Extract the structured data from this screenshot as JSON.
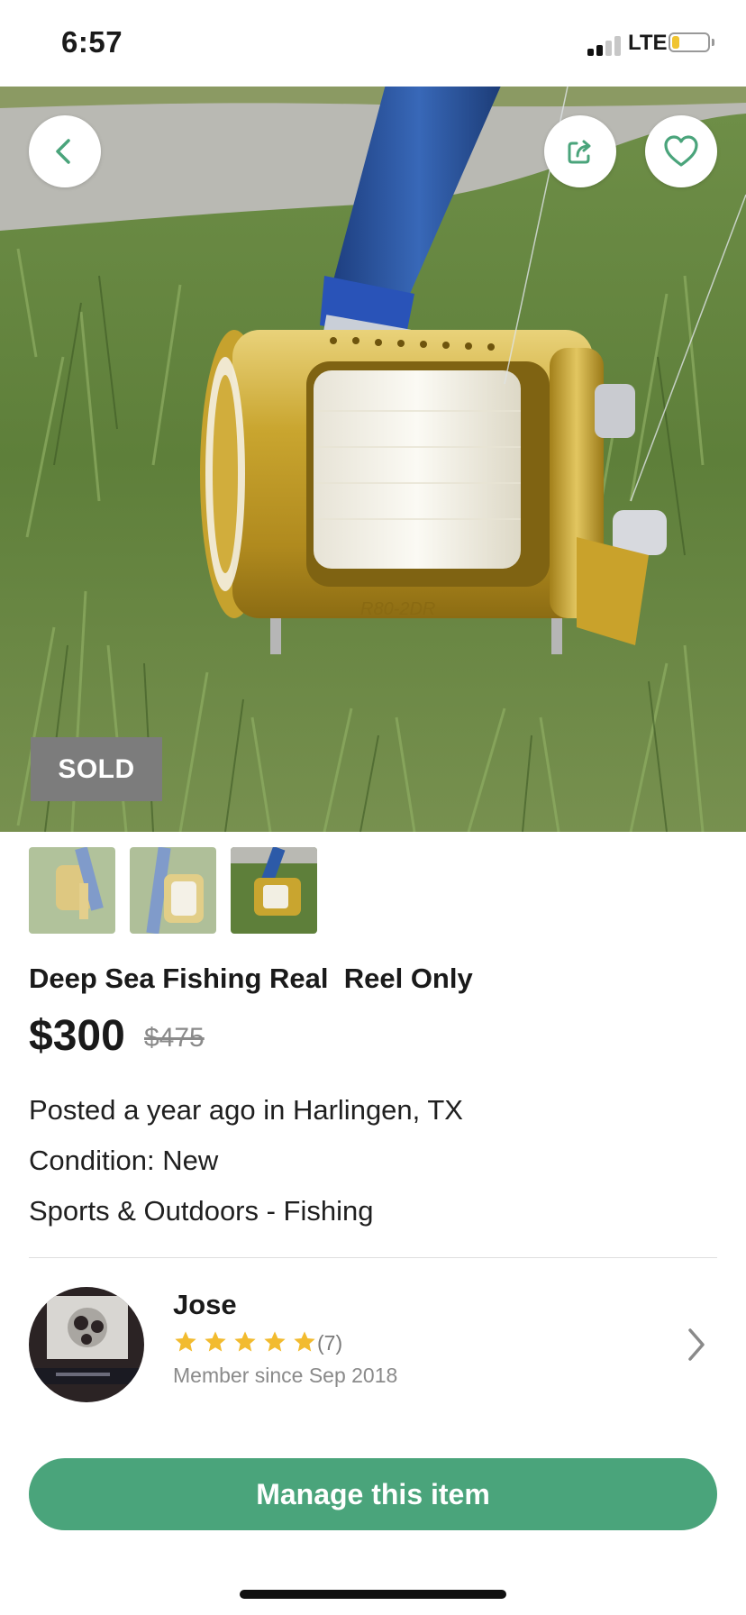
{
  "status_bar": {
    "time": "6:57",
    "network": "LTE"
  },
  "colors": {
    "accent": "#4aa47b",
    "star": "#f2bb2f",
    "sold_badge": "#7c7c7c"
  },
  "listing": {
    "sold_label": "SOLD",
    "title": "Deep Sea Fishing Real  Reel Only",
    "price": "$300",
    "original_price": "$475",
    "posted": "Posted a year ago in Harlingen, TX",
    "condition": "Condition: New",
    "category": "Sports & Outdoors - Fishing",
    "photo_count": 3,
    "selected_photo": 3
  },
  "seller": {
    "name": "Jose",
    "rating": 5,
    "review_count": "(7)",
    "member_since": "Member since Sep 2018"
  },
  "actions": {
    "manage_label": "Manage this item"
  },
  "icons": {
    "back": "chevron-left-icon",
    "share": "share-icon",
    "favorite": "heart-icon",
    "seller_link": "chevron-right-icon",
    "rating": "star-icon"
  }
}
